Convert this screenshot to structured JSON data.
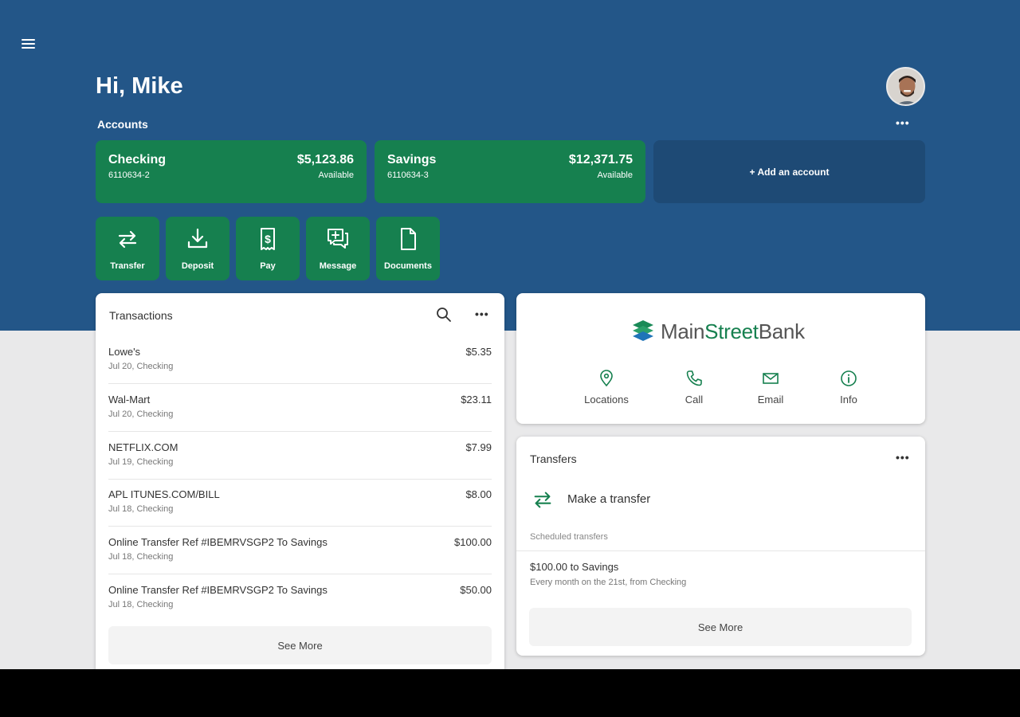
{
  "header": {
    "greeting": "Hi, Mike",
    "accounts_label": "Accounts",
    "more_label": "•••"
  },
  "accounts": [
    {
      "name": "Checking",
      "number": "6110634-2",
      "balance": "$5,123.86",
      "available_label": "Available"
    },
    {
      "name": "Savings",
      "number": "6110634-3",
      "balance": "$12,371.75",
      "available_label": "Available"
    }
  ],
  "add_account_label": "+ Add an account",
  "actions": [
    {
      "label": "Transfer",
      "icon": "transfer-icon"
    },
    {
      "label": "Deposit",
      "icon": "deposit-icon"
    },
    {
      "label": "Pay",
      "icon": "pay-icon"
    },
    {
      "label": "Message",
      "icon": "message-icon"
    },
    {
      "label": "Documents",
      "icon": "document-icon"
    }
  ],
  "transactions": {
    "title": "Transactions",
    "more_label": "•••",
    "see_more": "See More",
    "rows": [
      {
        "description": "Lowe's",
        "detail": "Jul 20, Checking",
        "amount": "$5.35"
      },
      {
        "description": "Wal-Mart",
        "detail": "Jul 20, Checking",
        "amount": "$23.11"
      },
      {
        "description": "NETFLIX.COM",
        "detail": "Jul 19, Checking",
        "amount": "$7.99"
      },
      {
        "description": "APL ITUNES.COM/BILL",
        "detail": "Jul 18, Checking",
        "amount": "$8.00"
      },
      {
        "description": "Online Transfer Ref #IBEMRVSGP2 To Savings",
        "detail": "Jul 18, Checking",
        "amount": "$100.00"
      },
      {
        "description": "Online Transfer Ref #IBEMRVSGP2 To Savings",
        "detail": "Jul 18, Checking",
        "amount": "$50.00"
      }
    ]
  },
  "bank": {
    "name_part1": "Main",
    "name_part2": "Street",
    "name_part3": "Bank",
    "contacts": [
      {
        "label": "Locations",
        "icon": "location-pin-icon"
      },
      {
        "label": "Call",
        "icon": "phone-icon"
      },
      {
        "label": "Email",
        "icon": "email-icon"
      },
      {
        "label": "Info",
        "icon": "info-icon"
      }
    ]
  },
  "transfers": {
    "title": "Transfers",
    "more_label": "•••",
    "make_transfer": "Make a transfer",
    "scheduled_label": "Scheduled transfers",
    "scheduled": [
      {
        "title": "$100.00 to Savings",
        "detail": "Every month on the 21st, from Checking"
      }
    ],
    "see_more": "See More"
  },
  "colors": {
    "header_blue": "#235688",
    "brand_green": "#16804f",
    "add_account_blue": "#1e4a75",
    "background_gray": "#e9e9ea"
  }
}
